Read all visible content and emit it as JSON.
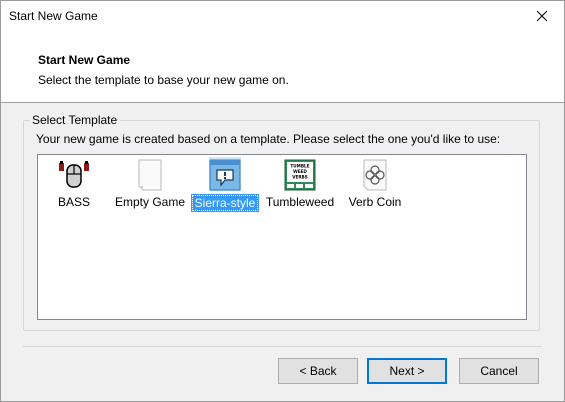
{
  "window": {
    "title": "Start New Game",
    "close_icon": "close-icon"
  },
  "header": {
    "title": "Start New Game",
    "subtitle": "Select the template to base your new game on."
  },
  "group": {
    "legend": "Select Template",
    "description": "Your new game is created based on a template. Please select the one you'd like to use:"
  },
  "templates": [
    {
      "label": "BASS",
      "icon": "bass-mouse-icon",
      "selected": false
    },
    {
      "label": "Empty Game",
      "icon": "blank-page-icon",
      "selected": false
    },
    {
      "label": "Sierra-style",
      "icon": "sierra-speech-icon",
      "selected": true
    },
    {
      "label": "Tumbleweed",
      "icon": "tumbleweed-verbs-icon",
      "selected": false
    },
    {
      "label": "Verb Coin",
      "icon": "verb-coin-icon",
      "selected": false
    }
  ],
  "tumbleweed_icon_text": "TUMBLE WEED VERBS",
  "buttons": {
    "back": "< Back",
    "next": "Next >",
    "cancel": "Cancel"
  },
  "colors": {
    "selection": "#3399ff",
    "default_button_border": "#0078d7",
    "dialog_bg": "#f0f0f0"
  }
}
